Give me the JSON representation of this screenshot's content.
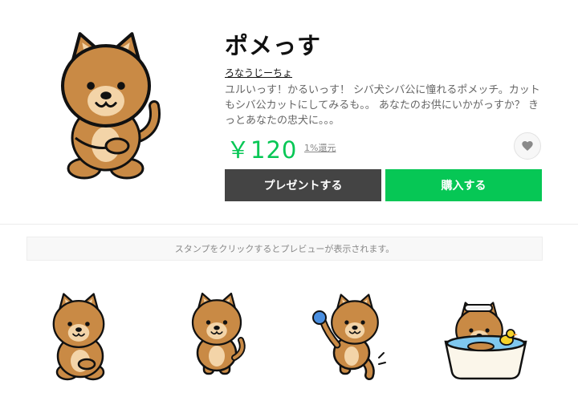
{
  "product": {
    "title": "ポメっす",
    "author": "ろなうじーちょ",
    "description": "ユルいっす！かるいっす！ シバ犬シバ公に憧れるポメッチ。カットもシバ公カットにしてみるも。。 あなたのお供にいかがっすか？ きっとあなたの忠犬に。。。",
    "price": "￥120",
    "reward": "1%還元"
  },
  "actions": {
    "gift_label": "プレゼントする",
    "buy_label": "購入する",
    "favorite_icon": "heart-icon"
  },
  "stickers": {
    "hint": "スタンプをクリックするとプレビューが表示されます。",
    "items": [
      {
        "name": "sitting-pomeranian"
      },
      {
        "name": "standing-pomeranian"
      },
      {
        "name": "waving-pomeranian"
      },
      {
        "name": "bathing-pomeranian"
      }
    ]
  },
  "colors": {
    "accent": "#06c755",
    "dark_button": "#444444",
    "fur": "#c98a45"
  }
}
